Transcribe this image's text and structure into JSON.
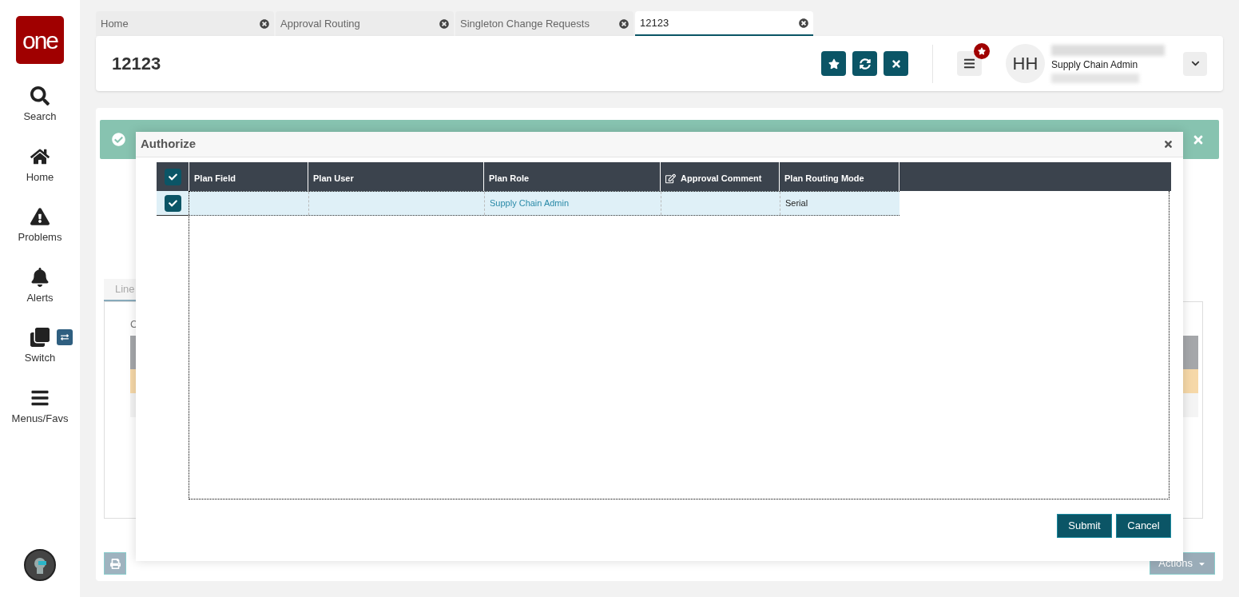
{
  "sidebar": {
    "logo": "one",
    "items": [
      {
        "kind": "search",
        "label": "Search"
      },
      {
        "kind": "home",
        "label": "Home"
      },
      {
        "kind": "problems",
        "label": "Problems"
      },
      {
        "kind": "alerts",
        "label": "Alerts"
      },
      {
        "kind": "switch",
        "label": "Switch"
      },
      {
        "kind": "menus",
        "label": "Menus/Favs"
      }
    ]
  },
  "tabs": [
    {
      "label": "Home",
      "selected": false
    },
    {
      "label": "Approval Routing",
      "selected": false
    },
    {
      "label": "Singleton Change Requests",
      "selected": false
    },
    {
      "label": "12123",
      "selected": true
    }
  ],
  "header": {
    "title": "12123",
    "user": {
      "initials": "HH",
      "role": "Supply Chain Admin"
    }
  },
  "background": {
    "tab_label": "Line",
    "column_label": "C",
    "actions": "Actions"
  },
  "dialog": {
    "title": "Authorize",
    "select_all_checked": true,
    "columns": [
      {
        "kind": "field",
        "label": "Plan Field"
      },
      {
        "kind": "user",
        "label": "Plan User"
      },
      {
        "kind": "role",
        "label": "Plan Role"
      },
      {
        "kind": "comment",
        "label": "Approval Comment"
      },
      {
        "kind": "mode",
        "label": "Plan Routing Mode"
      }
    ],
    "rows": [
      {
        "checked": true,
        "role": "Supply Chain Admin",
        "mode": "Serial"
      }
    ],
    "buttons": [
      "Submit",
      "Cancel"
    ]
  }
}
